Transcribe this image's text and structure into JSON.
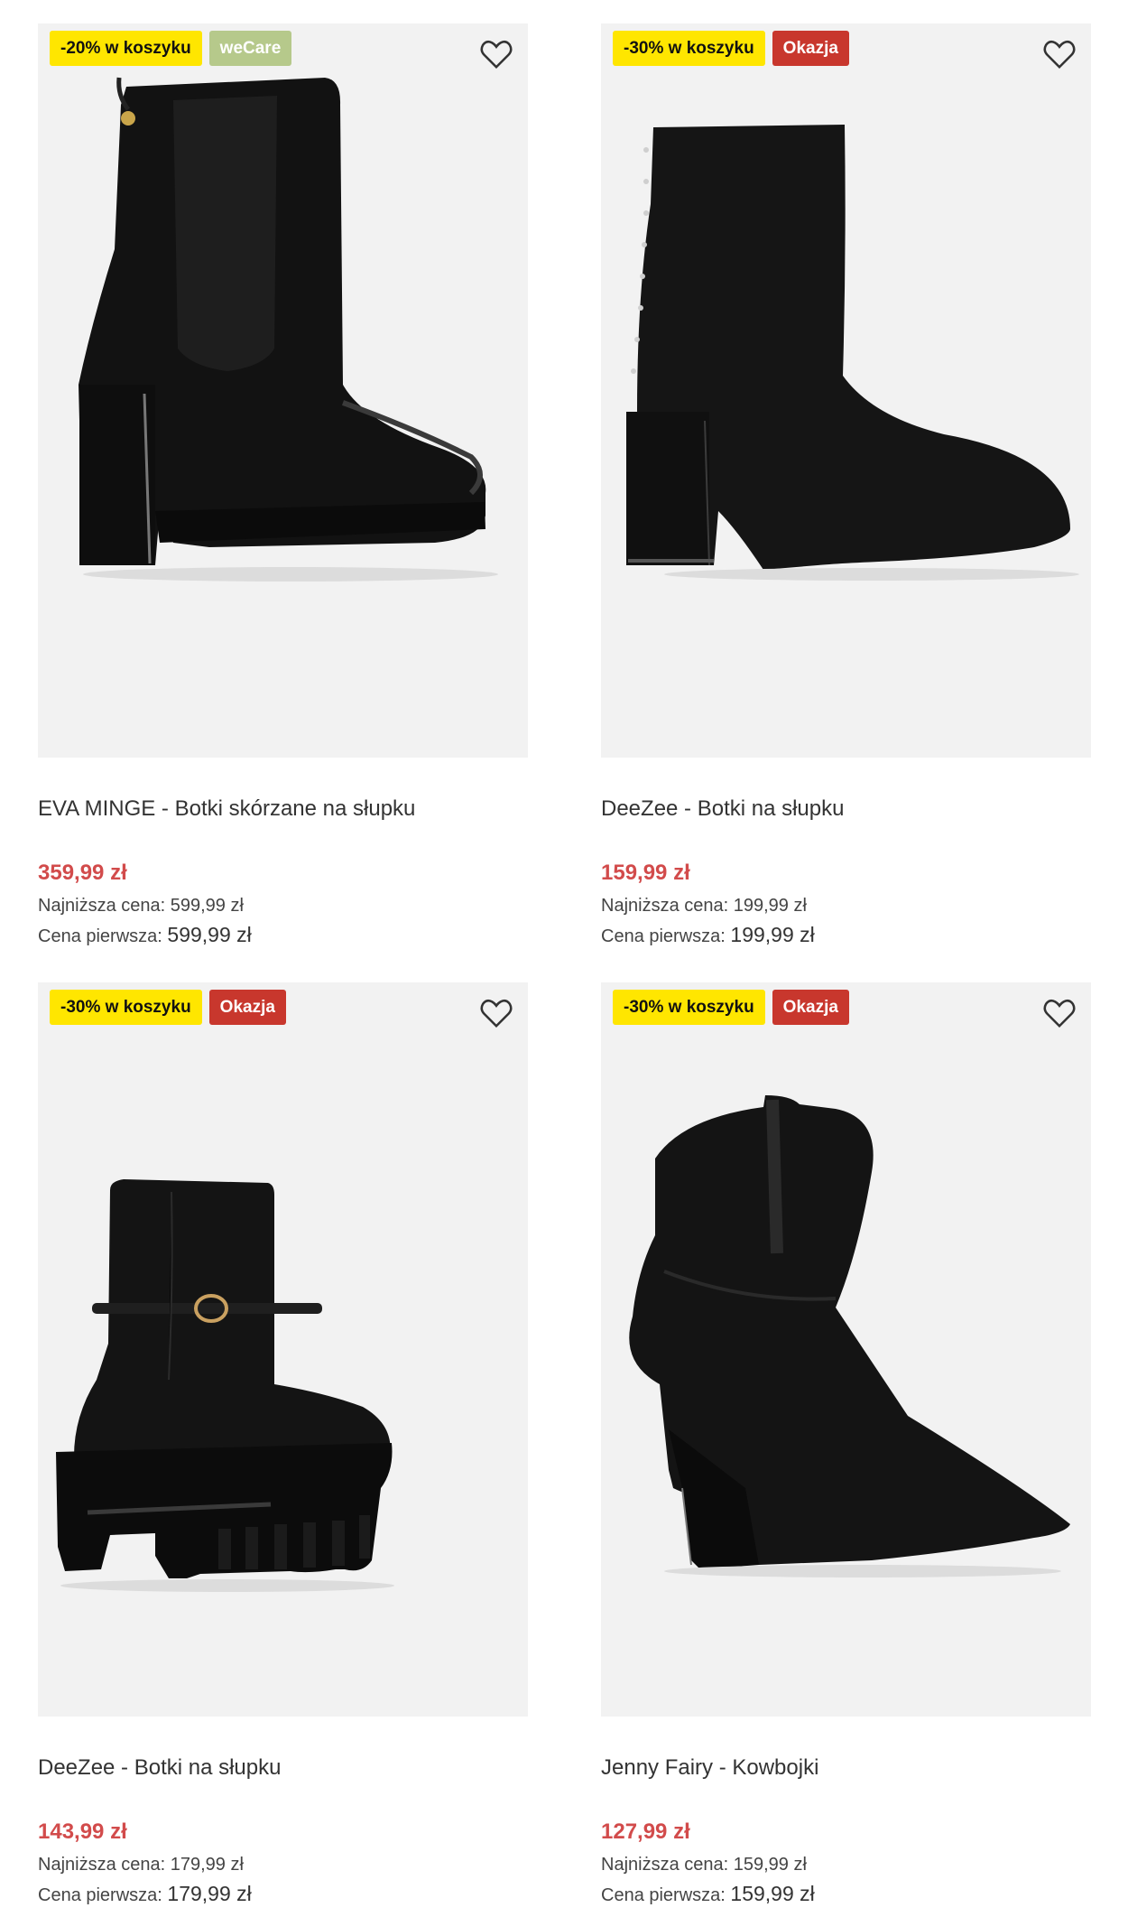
{
  "products": [
    {
      "badges": [
        {
          "text": "-20% w koszyku",
          "color": "#ffe600"
        },
        {
          "text": "weCare",
          "color": "#b6c98b"
        }
      ],
      "title": "EVA MINGE - Botki skórzane na słupku",
      "price": "359,99 zł",
      "lowest_label": "Najniższa cena:",
      "lowest_value": "599,99 zł",
      "first_label": "Cena pierwsza:",
      "first_value": "599,99 zł",
      "image": "black-patent-platform-chelsea-boot",
      "icon": "heart-icon"
    },
    {
      "badges": [
        {
          "text": "-30% w koszyku",
          "color": "#ffe600"
        },
        {
          "text": "Okazja",
          "color": "#c8372d"
        }
      ],
      "title": "DeeZee - Botki na słupku",
      "price": "159,99 zł",
      "lowest_label": "Najniższa cena:",
      "lowest_value": "199,99 zł",
      "first_label": "Cena pierwsza:",
      "first_value": "199,99 zł",
      "image": "black-suede-sock-boot",
      "icon": "heart-icon"
    },
    {
      "badges": [
        {
          "text": "-30% w koszyku",
          "color": "#ffe600"
        },
        {
          "text": "Okazja",
          "color": "#c8372d"
        }
      ],
      "title": "DeeZee - Botki na słupku",
      "price": "143,99 zł",
      "lowest_label": "Najniższa cena:",
      "lowest_value": "179,99 zł",
      "first_label": "Cena pierwsza:",
      "first_value": "179,99 zł",
      "image": "black-chunky-buckle-boot",
      "icon": "heart-icon"
    },
    {
      "badges": [
        {
          "text": "-30% w koszyku",
          "color": "#ffe600"
        },
        {
          "text": "Okazja",
          "color": "#c8372d"
        }
      ],
      "title": "Jenny Fairy - Kowbojki",
      "price": "127,99 zł",
      "lowest_label": "Najniższa cena:",
      "lowest_value": "159,99 zł",
      "first_label": "Cena pierwsza:",
      "first_value": "159,99 zł",
      "image": "black-suede-cowboy-boot",
      "icon": "heart-icon"
    }
  ]
}
